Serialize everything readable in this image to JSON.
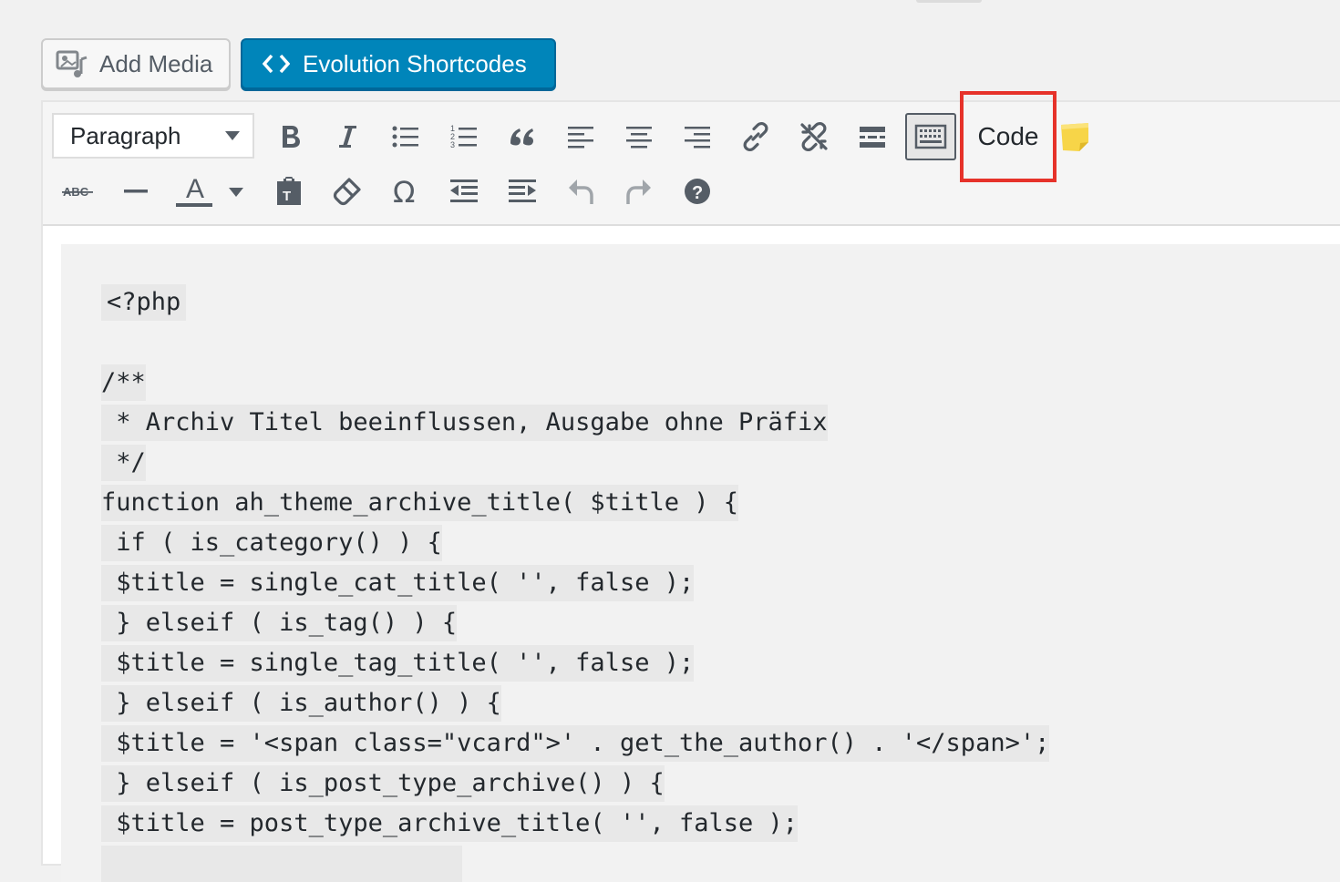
{
  "media_buttons": {
    "add_media_label": "Add Media",
    "evolution_label": "Evolution Shortcodes"
  },
  "colors": {
    "primary_button": "#0085ba",
    "highlight_border": "#e6322a",
    "code_background": "#e8e8e8"
  },
  "toolbar": {
    "format_select_value": "Paragraph",
    "code_button_label": "Code",
    "row1_icons": [
      "bold-icon",
      "italic-icon",
      "bulleted-list-icon",
      "numbered-list-icon",
      "blockquote-icon",
      "align-left-icon",
      "align-center-icon",
      "align-right-icon",
      "link-icon",
      "unlink-icon",
      "read-more-icon",
      "toolbar-toggle-icon",
      "code-button",
      "sticky-note-icon"
    ],
    "row2_icons": [
      "strikethrough-icon",
      "horizontal-line-icon",
      "text-color-icon",
      "paste-as-text-icon",
      "clear-formatting-icon",
      "special-character-icon",
      "outdent-icon",
      "indent-icon",
      "undo-icon",
      "redo-icon",
      "help-icon"
    ]
  },
  "content": {
    "code_lines": [
      "<?php",
      "",
      "/**",
      " * Archiv Titel beeinflussen, Ausgabe ohne Präfix",
      " */",
      "function ah_theme_archive_title( $title ) {",
      " if ( is_category() ) {",
      " $title = single_cat_title( '', false );",
      " } elseif ( is_tag() ) {",
      " $title = single_tag_title( '', false );",
      " } elseif ( is_author() ) {",
      " $title = '<span class=\"vcard\">' . get_the_author() . '</span>';",
      " } elseif ( is_post_type_archive() ) {",
      " $title = post_type_archive_title( '', false );"
    ]
  }
}
